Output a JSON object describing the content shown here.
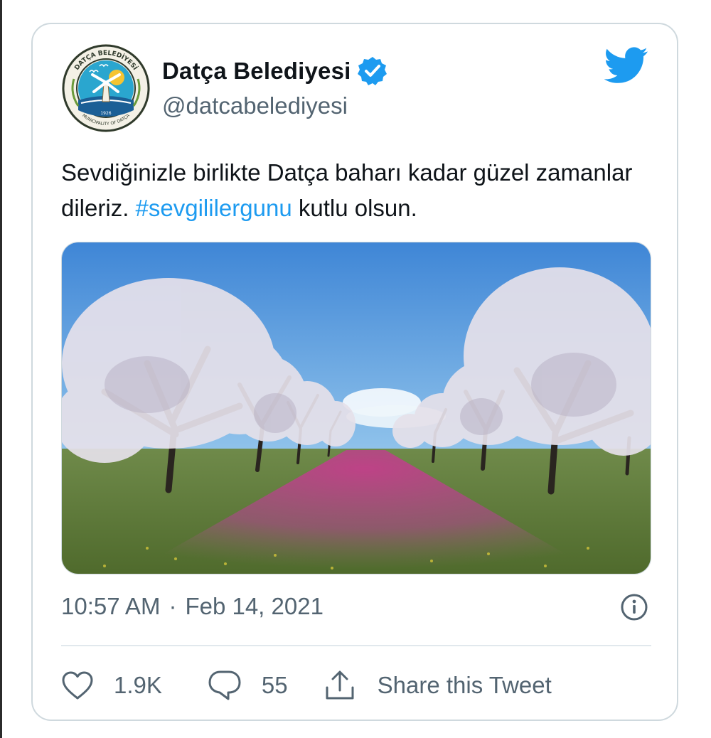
{
  "tweet": {
    "display_name": "Datça Belediyesi",
    "handle": "@datcabelediyesi",
    "text_before": "Sevdiğinizle birlikte Datça baharı kadar güzel zamanlar dileriz. ",
    "hashtag": "#sevgililergunu",
    "text_after": " kutlu olsun.",
    "time": "10:57 AM",
    "separator": "·",
    "date": "Feb 14, 2021",
    "likes": "1.9K",
    "replies": "55",
    "share_label": "Share this Tweet"
  },
  "avatar_logo": {
    "ring_text_top": "DATÇA BELEDİYESİ",
    "ring_text_bottom": "MUNICIPALITY OF DATÇA",
    "year": "1926"
  },
  "icons": {
    "brand": "twitter-bird-icon",
    "verified": "verified-badge-icon",
    "info": "info-icon",
    "like": "heart-icon",
    "reply": "speech-bubble-icon",
    "share": "share-upload-icon"
  },
  "colors": {
    "text": "#0f1419",
    "secondary": "#536471",
    "accent": "#1d9bf0",
    "border": "#cfd9de"
  }
}
